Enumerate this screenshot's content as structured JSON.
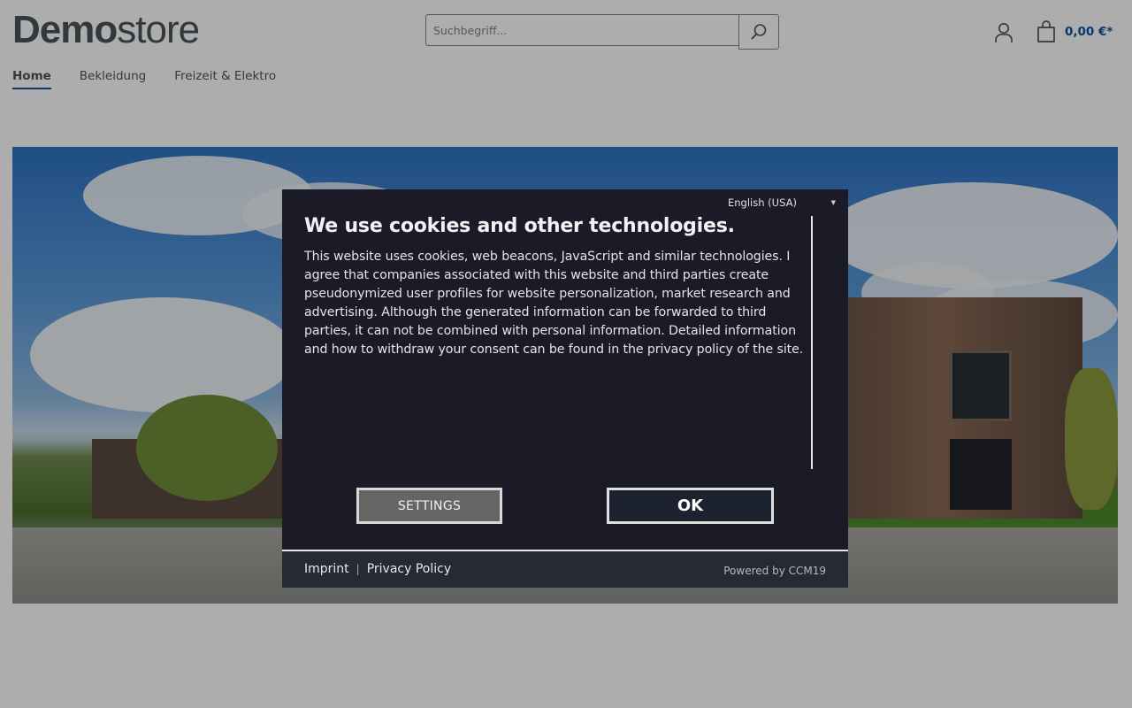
{
  "header": {
    "logo_bold": "Demo",
    "logo_light": "store",
    "search_placeholder": "Suchbegriff...",
    "search_icon": "search-icon",
    "account_icon": "user-icon",
    "cart_icon": "shopping-bag-icon",
    "cart_total": "0,00 €*"
  },
  "nav": {
    "items": [
      {
        "label": "Home",
        "active": true
      },
      {
        "label": "Bekleidung",
        "active": false
      },
      {
        "label": "Freizeit & Elektro",
        "active": false
      }
    ]
  },
  "cookie_modal": {
    "language": "English (USA)",
    "title": "We use cookies and other technologies.",
    "body": "This website uses cookies, web beacons, JavaScript and similar technologies. I agree that companies associated with this website and third parties create pseudonymized user profiles for website personalization, market research and advertising. Although the generated information can be forwarded to third parties, it can not be combined with personal information. Detailed information and how to withdraw your consent can be found in the privacy policy of the site.",
    "settings_label": "SETTINGS",
    "ok_label": "OK",
    "footer": {
      "imprint": "Imprint",
      "privacy": "Privacy Policy",
      "powered_by": "Powered by CCM19"
    }
  },
  "colors": {
    "accent": "#0b539b",
    "text": "#4a545b",
    "modal_bg": "#1b1b27"
  }
}
